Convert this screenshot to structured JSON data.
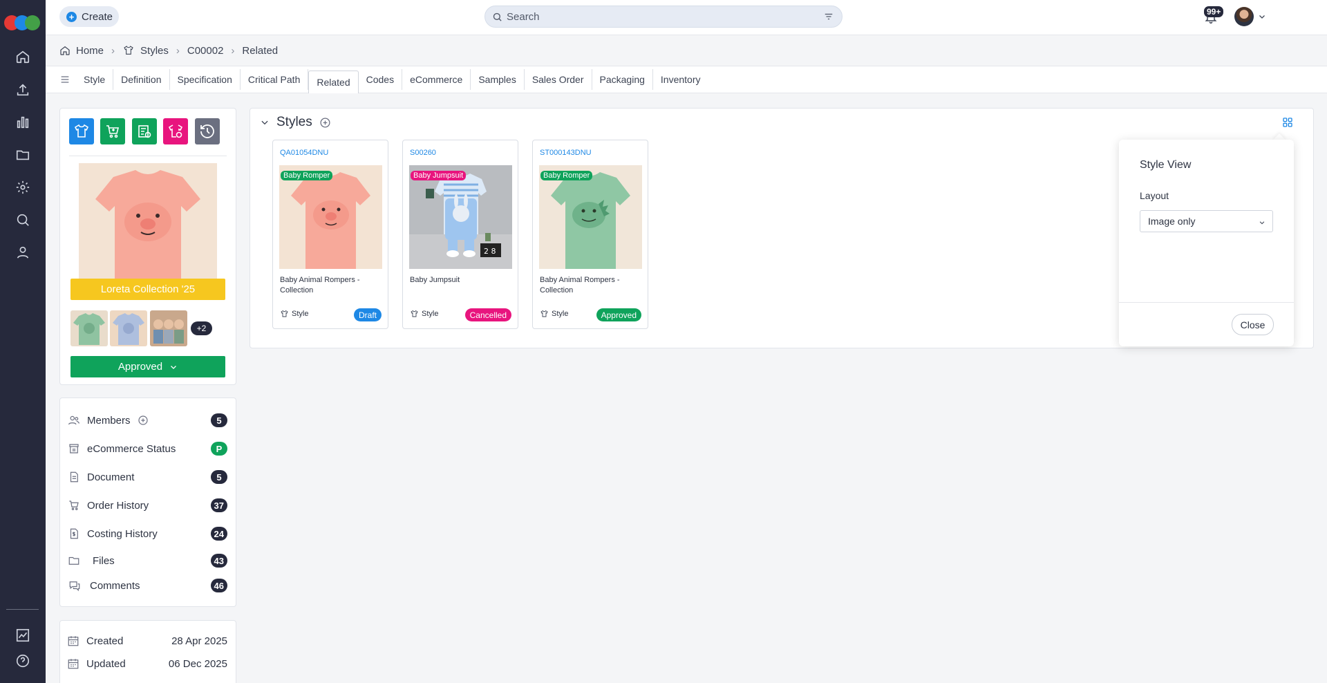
{
  "topbar": {
    "create_label": "Create",
    "search_placeholder": "Search",
    "notification_badge": "99+"
  },
  "breadcrumb": {
    "home": "Home",
    "styles": "Styles",
    "code": "C00002",
    "current": "Related"
  },
  "tabs": [
    "Style",
    "Definition",
    "Specification",
    "Critical Path",
    "Related",
    "Codes",
    "eCommerce",
    "Samples",
    "Sales Order",
    "Packaging",
    "Inventory"
  ],
  "active_tab": "Related",
  "product": {
    "collection": "Loreta Collection '25",
    "more_images": "+2",
    "status": "Approved"
  },
  "links": {
    "members": {
      "label": "Members",
      "count": "5"
    },
    "ecommerce": {
      "label": "eCommerce Status",
      "count": "P"
    },
    "document": {
      "label": "Document",
      "count": "5"
    },
    "orders": {
      "label": "Order History",
      "count": "37"
    },
    "costing": {
      "label": "Costing History",
      "count": "24"
    },
    "files": {
      "label": "Files",
      "count": "43"
    },
    "comments": {
      "label": "Comments",
      "count": "46"
    }
  },
  "dates": {
    "created_label": "Created",
    "created": "28 Apr 2025",
    "updated_label": "Updated",
    "updated": "06 Dec 2025"
  },
  "section": {
    "title": "Styles"
  },
  "cards": [
    {
      "code": "QA01054DNU",
      "tag": "Baby Romper",
      "name": "Baby Animal Rompers - Collection",
      "type": "Style",
      "status": "Draft"
    },
    {
      "code": "S00260",
      "tag": "Baby Jumpsuit",
      "name": "Baby Jumpsuit",
      "type": "Style",
      "status": "Cancelled"
    },
    {
      "code": "ST000143DNU",
      "tag": "Baby Romper",
      "name": "Baby Animal Rompers - Collection",
      "type": "Style",
      "status": "Approved"
    }
  ],
  "popover": {
    "title": "Style View",
    "layout_label": "Layout",
    "layout_value": "Image only",
    "close_label": "Close"
  },
  "colors": {
    "rail": "#26293c",
    "accent_blue": "#1e88e5",
    "green": "#0fa35b",
    "pink": "#e8157e",
    "yellow": "#f6c71f",
    "grey": "#6b6f80"
  }
}
